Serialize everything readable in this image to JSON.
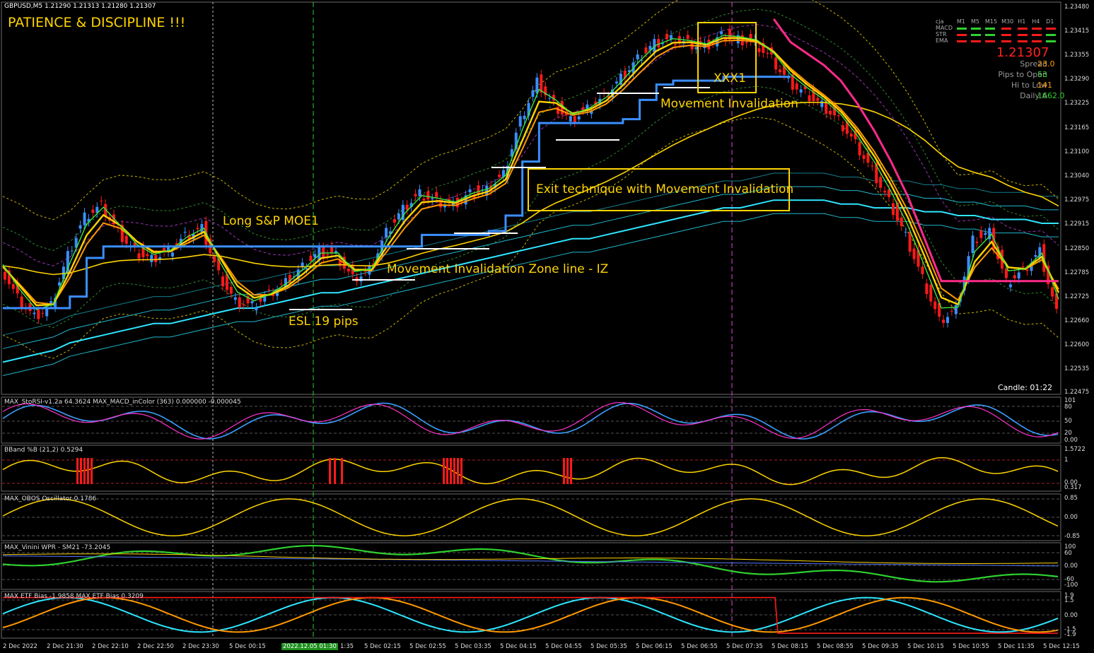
{
  "header": {
    "symbol_line": "GBPUSD,M5  1.21290 1.21313 1.21280 1.21307",
    "motto": "PATIENCE & DISCIPLINE !!!"
  },
  "panel": {
    "cols": [
      "cja",
      "M1",
      "M5",
      "M15",
      "M30",
      "H1",
      "H4",
      "D1"
    ],
    "rows": [
      "MACD",
      "STR",
      "EMA"
    ],
    "current_price": "1.21307",
    "spread_label": "Spread",
    "spread_value": "23.0",
    "pips_open_label": "Pips to Open",
    "pips_open_value": "53",
    "hi_low_label": "Hi to Low",
    "hi_low_value": "141",
    "daily_label": "Daily A",
    "daily_value": "1662.0",
    "candle": "Candle:  01:22"
  },
  "annotations": {
    "long_entry": "Long S&P MOE1",
    "iz_line": "Movement Invalidation Zone line - IZ",
    "esl": "ESL 19 pips",
    "exit_box": "Exit technique with Movement Invalidation",
    "movement_invalidation": "Movement Invalidation",
    "xxx1": "XXX1"
  },
  "subwindows": {
    "w1": "MAX_StoRSI-v1.2a 64.3624  MAX_MACD_inColor (363) 0.000000 -0.000045",
    "w2": "BBand %B (21,2) 0.5294",
    "w3": "MAX_OBOS Oscillator 0.1786",
    "w4": "MAX_Vinini WPR - SM21 -73.2045",
    "w5": "MAX ETF Bias -1.9858  MAX ETF  Bias 0.3209"
  },
  "price_axis": [
    "1.23480",
    "1.23415",
    "1.23355",
    "1.23290",
    "1.23225",
    "1.23165",
    "1.23100",
    "1.23040",
    "1.22975",
    "1.22915",
    "1.22850",
    "1.22785",
    "1.22725",
    "1.22660",
    "1.22600",
    "1.22535",
    "1.22475"
  ],
  "sub_axis": {
    "w1": [
      "101",
      "80",
      "50",
      "20",
      "0.00"
    ],
    "w2": [
      "1.5722",
      "1",
      "0.00",
      "0.317"
    ],
    "w3": [
      "0.85",
      "0.00",
      "-0.85"
    ],
    "w4": [
      "100",
      "60",
      "0.00",
      "-60",
      "-100"
    ],
    "w5": [
      "1.9",
      "1.5",
      "0.00",
      "-1.5",
      "-1.9"
    ]
  },
  "time_axis": [
    "2 Dec 2022",
    "2 Dec 21:30",
    "2 Dec 22:10",
    "2 Dec 22:50",
    "2 Dec 23:30",
    "5 Dec 00:15",
    "2022.12.05 01:30",
    "1:35",
    "5 Dec 02:15",
    "5 Dec 02:55",
    "5 Dec 03:35",
    "5 Dec 04:15",
    "5 Dec 04:55",
    "5 Dec 05:35",
    "5 Dec 06:15",
    "5 Dec 06:55",
    "5 Dec 07:35",
    "5 Dec 08:15",
    "5 Dec 08:55",
    "5 Dec 09:35",
    "5 Dec 10:15",
    "5 Dec 10:55",
    "5 Dec 11:35",
    "5 Dec 12:15"
  ],
  "colors": {
    "bull": "#3a8fff",
    "bear": "#ff1a1a",
    "yellow": "#ffd400",
    "orange": "#ff9900",
    "pink": "#ff2b8a",
    "cyan": "#2ee6ff"
  },
  "chart_data": {
    "type": "line",
    "title": "GBPUSD,M5",
    "ylim": [
      1.2247,
      1.2348
    ],
    "series": [
      {
        "values": [
          1.228,
          1.2272,
          1.2267,
          1.227,
          1.2283,
          1.2293,
          1.2296,
          1.2289,
          1.2284,
          1.2282,
          1.2284,
          1.2288,
          1.229,
          1.2278,
          1.2271,
          1.227,
          1.2273,
          1.2276,
          1.228,
          1.2284,
          1.2283,
          1.2277,
          1.2279,
          1.2289,
          1.2295,
          1.2299,
          1.2297,
          1.2296,
          1.2299,
          1.23,
          1.2304,
          1.2318,
          1.2328,
          1.2322,
          1.2318,
          1.2321,
          1.2324,
          1.2329,
          1.2334,
          1.2338,
          1.2339,
          1.2338,
          1.2337,
          1.234,
          1.2339,
          1.2338,
          1.2334,
          1.2328,
          1.2325,
          1.2322,
          1.2318,
          1.2312,
          1.2305,
          1.2297,
          1.2288,
          1.2277,
          1.2266,
          1.2269,
          1.2287,
          1.2289,
          1.2276,
          1.2279,
          1.2284,
          1.2268
        ]
      },
      {
        "values": [
          1.2255,
          1.2256,
          1.2257,
          1.2258,
          1.226,
          1.2261,
          1.2262,
          1.2263,
          1.2264,
          1.2265,
          1.2265,
          1.2266,
          1.2267,
          1.2268,
          1.2269,
          1.2269,
          1.227,
          1.2271,
          1.2272,
          1.2273,
          1.2273,
          1.2274,
          1.2275,
          1.2276,
          1.2277,
          1.2278,
          1.2279,
          1.228,
          1.2281,
          1.2282,
          1.2283,
          1.2284,
          1.2285,
          1.2286,
          1.2287,
          1.2287,
          1.2288,
          1.2289,
          1.229,
          1.2291,
          1.2292,
          1.2293,
          1.2294,
          1.2295,
          1.2295,
          1.2296,
          1.2297,
          1.2297,
          1.2297,
          1.2297,
          1.2296,
          1.2296,
          1.2295,
          1.2295,
          1.2295,
          1.2294,
          1.2294,
          1.2293,
          1.2293,
          1.2292,
          1.2292,
          1.2292,
          1.2291,
          1.2291
        ]
      }
    ]
  }
}
